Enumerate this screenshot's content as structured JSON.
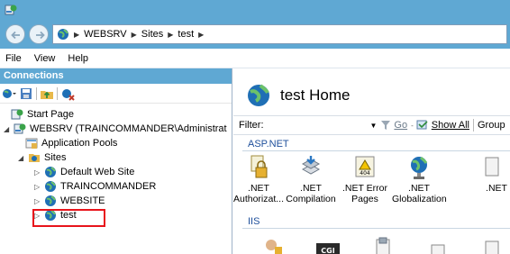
{
  "address": {
    "segments": [
      "WEBSRV",
      "Sites",
      "test"
    ]
  },
  "menu": [
    {
      "label": "File"
    },
    {
      "label": "View"
    },
    {
      "label": "Help"
    }
  ],
  "connections": {
    "title": "Connections",
    "tree": [
      {
        "label": "Start Page",
        "icon": "start-page-icon",
        "level": 0,
        "expander": ""
      },
      {
        "label": "WEBSRV (TRAINCOMMANDER\\Administrat",
        "icon": "server-icon",
        "level": 0,
        "expander": "◢"
      },
      {
        "label": "Application Pools",
        "icon": "app-pools-icon",
        "level": 1,
        "expander": ""
      },
      {
        "label": "Sites",
        "icon": "sites-folder-icon",
        "level": 1,
        "expander": "◢"
      },
      {
        "label": "Default Web Site",
        "icon": "website-globe-icon",
        "level": 2,
        "expander": "▷"
      },
      {
        "label": "TRAINCOMMANDER",
        "icon": "website-globe-icon",
        "level": 2,
        "expander": "▷"
      },
      {
        "label": "WEBSITE",
        "icon": "website-globe-icon",
        "level": 2,
        "expander": "▷"
      },
      {
        "label": "test",
        "icon": "website-globe-icon",
        "level": 2,
        "expander": "▷",
        "selected": true
      }
    ]
  },
  "home": {
    "title": "test Home"
  },
  "filterbar": {
    "filter_label": "Filter:",
    "go_label": "Go",
    "show_all_label": "Show All",
    "group_label": "Group"
  },
  "groups": [
    {
      "name": "ASP.NET",
      "features": [
        {
          "line1": ".NET",
          "line2": "Authorizat...",
          "icon": "authorization-icon"
        },
        {
          "line1": ".NET",
          "line2": "Compilation",
          "icon": "compilation-icon"
        },
        {
          "line1": ".NET Error",
          "line2": "Pages",
          "icon": "error-pages-icon"
        },
        {
          "line1": ".NET",
          "line2": "Globalization",
          "icon": "globalization-icon"
        },
        {
          "line1": ".NET",
          "line2": "",
          "icon": "profile-icon"
        }
      ]
    },
    {
      "name": "IIS",
      "features": [
        {
          "icon": "authentication-icon"
        },
        {
          "icon": "cgi-icon",
          "text": "CGI"
        },
        {
          "icon": "compression-icon"
        },
        {
          "icon": "default-document-icon"
        },
        {
          "icon": "directory-browsing-icon"
        }
      ]
    }
  ],
  "colors": {
    "chrome_blue": "#5fa8d3",
    "selection_highlight": "#e8141b",
    "group_text": "#1e4f9b"
  }
}
